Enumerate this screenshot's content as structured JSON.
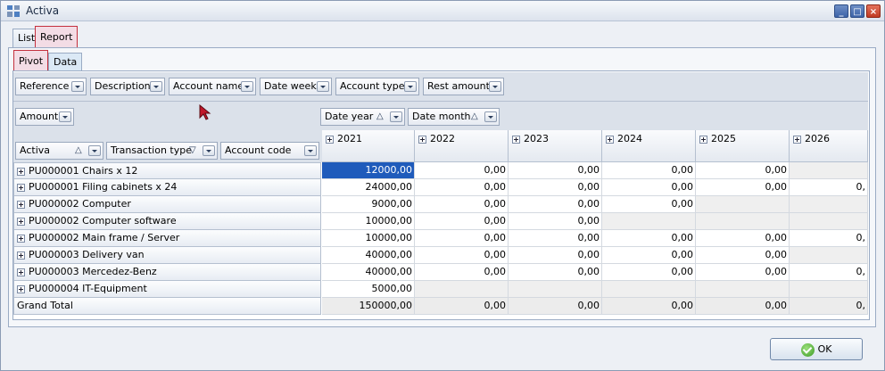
{
  "window": {
    "title": "Activa"
  },
  "tabs": {
    "outer": [
      "List",
      "Report"
    ],
    "inner": [
      "Pivot",
      "Data"
    ]
  },
  "filter_fields": [
    "Reference",
    "Description",
    "Account name",
    "Date week",
    "Account type",
    "Rest amount"
  ],
  "data_field": "Amount",
  "column_fields": [
    "Date year",
    "Date month"
  ],
  "row_fields": [
    "Activa",
    "Transaction type",
    "Account code"
  ],
  "columns": [
    "2021",
    "2022",
    "2023",
    "2024",
    "2025",
    "2026"
  ],
  "rows": [
    {
      "label": "PU000001 Chairs x 12",
      "values": [
        "12000,00",
        "0,00",
        "0,00",
        "0,00",
        "0,00",
        ""
      ]
    },
    {
      "label": "PU000001 Filing cabinets x 24",
      "values": [
        "24000,00",
        "0,00",
        "0,00",
        "0,00",
        "0,00",
        "0,"
      ]
    },
    {
      "label": "PU000002 Computer",
      "values": [
        "9000,00",
        "0,00",
        "0,00",
        "0,00",
        "",
        ""
      ]
    },
    {
      "label": "PU000002 Computer software",
      "values": [
        "10000,00",
        "0,00",
        "0,00",
        "",
        "",
        ""
      ]
    },
    {
      "label": "PU000002 Main frame / Server",
      "values": [
        "10000,00",
        "0,00",
        "0,00",
        "0,00",
        "0,00",
        "0,"
      ]
    },
    {
      "label": "PU000003 Delivery van",
      "values": [
        "40000,00",
        "0,00",
        "0,00",
        "0,00",
        "0,00",
        ""
      ]
    },
    {
      "label": "PU000003 Mercedez-Benz",
      "values": [
        "40000,00",
        "0,00",
        "0,00",
        "0,00",
        "0,00",
        "0,"
      ]
    },
    {
      "label": "PU000004 IT-Equipment",
      "values": [
        "5000,00",
        "",
        "",
        "",
        "",
        ""
      ]
    }
  ],
  "grand_total": {
    "label": "Grand Total",
    "values": [
      "150000,00",
      "0,00",
      "0,00",
      "0,00",
      "0,00",
      "0,"
    ]
  },
  "ok_button": "OK"
}
